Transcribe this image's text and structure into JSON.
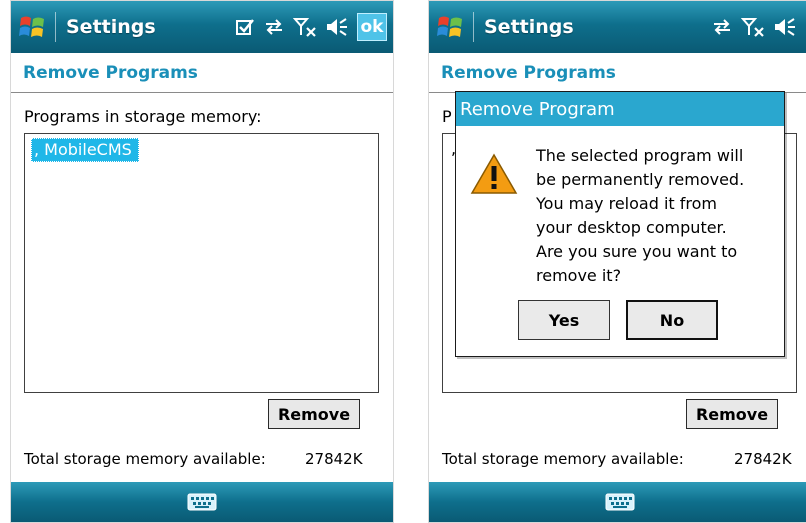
{
  "screens": [
    {
      "title": "Settings",
      "show_ok": true,
      "ok_label": "ok",
      "header": "Remove Programs",
      "list_label": "Programs in storage memory:",
      "list_items": [
        ", MobileCMS"
      ],
      "remove_label": "Remove",
      "footer_label": "Total storage memory available:",
      "footer_value": "27842K"
    },
    {
      "title": "Settings",
      "show_ok": false,
      "header": "Remove Programs",
      "list_label_partial": "P",
      "list_item_partial": ",",
      "remove_label": "Remove",
      "footer_label": "Total storage memory available:",
      "footer_value": "27842K",
      "dialog": {
        "title": "Remove Program",
        "message_lines": [
          "The selected program will",
          "be permanently removed.",
          "You may reload it from",
          "your desktop computer.",
          "Are you sure you want to",
          "remove it?"
        ],
        "yes_label": "Yes",
        "no_label": "No"
      }
    }
  ],
  "colors": {
    "bar_top": "#2d9ab8",
    "bar_bottom": "#0a5a74",
    "header_text": "#1a8fb8",
    "selection": "#1fb7e8",
    "dialog_title": "#2aa7cf",
    "warning": "#f39c12"
  },
  "icons": [
    "windows-start-icon",
    "checkbox-icon",
    "sync-arrows-icon",
    "signal-off-icon",
    "volume-off-icon",
    "keyboard-icon",
    "warning-icon"
  ]
}
